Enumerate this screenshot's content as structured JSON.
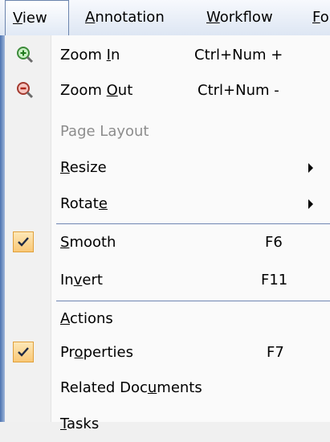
{
  "menubar": {
    "items": [
      {
        "pre": "",
        "u": "V",
        "post": "iew"
      },
      {
        "pre": "",
        "u": "A",
        "post": "nnotation"
      },
      {
        "pre": "",
        "u": "W",
        "post": "orkflow"
      },
      {
        "pre": "",
        "u": "F",
        "post": "o"
      }
    ]
  },
  "menu": {
    "items": [
      {
        "pre": "Zoom ",
        "u": "I",
        "post": "n",
        "shortcut": "Ctrl+Num +"
      },
      {
        "pre": "Zoom ",
        "u": "O",
        "post": "ut",
        "shortcut": "Ctrl+Num -"
      },
      {
        "label": "Page Layout"
      },
      {
        "pre": "",
        "u": "R",
        "post": "esize"
      },
      {
        "pre": "Rotat",
        "u": "e",
        "post": ""
      },
      {
        "pre": "",
        "u": "S",
        "post": "mooth",
        "shortcut": "F6"
      },
      {
        "pre": "In",
        "u": "v",
        "post": "ert",
        "shortcut": "F11"
      },
      {
        "pre": "",
        "u": "A",
        "post": "ctions"
      },
      {
        "pre": "Pr",
        "u": "o",
        "post": "perties",
        "shortcut": "F7"
      },
      {
        "pre": "Related Doc",
        "u": "u",
        "post": "ments"
      },
      {
        "pre": "",
        "u": "T",
        "post": "asks"
      }
    ]
  },
  "colors": {
    "menu_edge": "#4b72b0",
    "separator": "#6f86b3",
    "check_bg": "#f9c877",
    "disabled_text": "#8d8d8d"
  },
  "icons": {
    "zoom_in": "magnifier-plus-icon",
    "zoom_out": "magnifier-minus-icon",
    "submenu": "submenu-arrow-icon",
    "checked": "checkmark-icon"
  }
}
